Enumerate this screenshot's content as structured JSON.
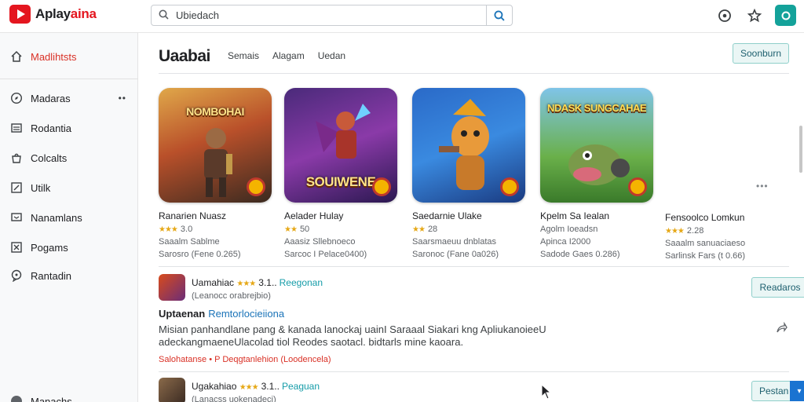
{
  "app": {
    "name_part1": "Aplay",
    "name_part2": "aina"
  },
  "search": {
    "value": "Ubiedach"
  },
  "icons": {
    "logo": "play-logo-icon",
    "search": "search-icon",
    "settings": "settings-icon",
    "favorite": "star-icon",
    "account": "account-icon"
  },
  "sidebar": {
    "items": [
      {
        "label": "Madlihtsts",
        "icon": "home-icon",
        "active": true
      },
      {
        "label": "Madaras",
        "icon": "compass-icon",
        "more": "••"
      },
      {
        "label": "Rodantia",
        "icon": "list-icon"
      },
      {
        "label": "Colcalts",
        "icon": "bag-icon"
      },
      {
        "label": "Utilk",
        "icon": "edit-icon"
      },
      {
        "label": "Nanamlans",
        "icon": "monitor-icon"
      },
      {
        "label": "Pogams",
        "icon": "expand-icon"
      },
      {
        "label": "Rantadin",
        "icon": "chat-icon"
      }
    ],
    "bottom_label": "Manachs"
  },
  "main": {
    "title": "Uaabai",
    "tabs": [
      "Semais",
      "Alagam",
      "Uedan"
    ],
    "top_button": "Soonburn"
  },
  "cards": [
    {
      "art_text": "NOMBOHAI",
      "title": "Ranarien Nuasz",
      "rating": "3.0",
      "extra": "Saaalm Sablme",
      "meta": "Sarosro (Fene 0.265)"
    },
    {
      "art_text": "SOUIWENE",
      "title": "Aelader Hulay",
      "rating": "50",
      "extra": "Aaasiz Sllebnoeco",
      "meta": "Sarcoc I Pelace0400)"
    },
    {
      "art_text": "",
      "title": "Saedarnie Ulake",
      "rating": "28",
      "extra": "Saarsmaeuu dnblatas",
      "meta": "Saronoc (Fane 0a026)"
    },
    {
      "art_text": "NDASK SUNGCAHAE",
      "title": "Kpelm Sa Iealan",
      "rating": "",
      "extra": "Agolm Ioeadsn",
      "extra2": "Apinca I2000",
      "meta": "Sadode Gaes 0.286)"
    },
    {
      "art_text": "",
      "title": "Fensoolco Lomkun",
      "rating": "2.28",
      "extra": "Saaalm sanuaciaeso",
      "meta": "Sarlinsk Fars (t 0.66)"
    }
  ],
  "list": [
    {
      "title": "Uamahiac",
      "rating": "3.1..",
      "tag": "Reegonan",
      "sub": "(Leanocc orabrejbio)",
      "button": "Readaros"
    },
    {
      "title": "Ugakahiao",
      "rating": "3.1..",
      "tag": "Peaguan",
      "sub": "(Lanacss uokenadeci)",
      "button": "Pestan"
    }
  ],
  "description": {
    "title": "Uptaenan",
    "link": "Remtorlocieiiona",
    "text": "Misian panhandlane pang & kanada lanockaj uainI Saraaal Siakari kng ApliukanoieeU adeckangmaeneUlacolad tiol Reodes saotacl. bidtarls mine kaoara.",
    "red_link": "Salohatanse • P Deqgtanlehion (Loodencela)"
  },
  "colors": {
    "brand_red": "#e4161f",
    "teal": "#14a29a",
    "link_blue": "#1a73b8",
    "star": "#e6a817"
  }
}
